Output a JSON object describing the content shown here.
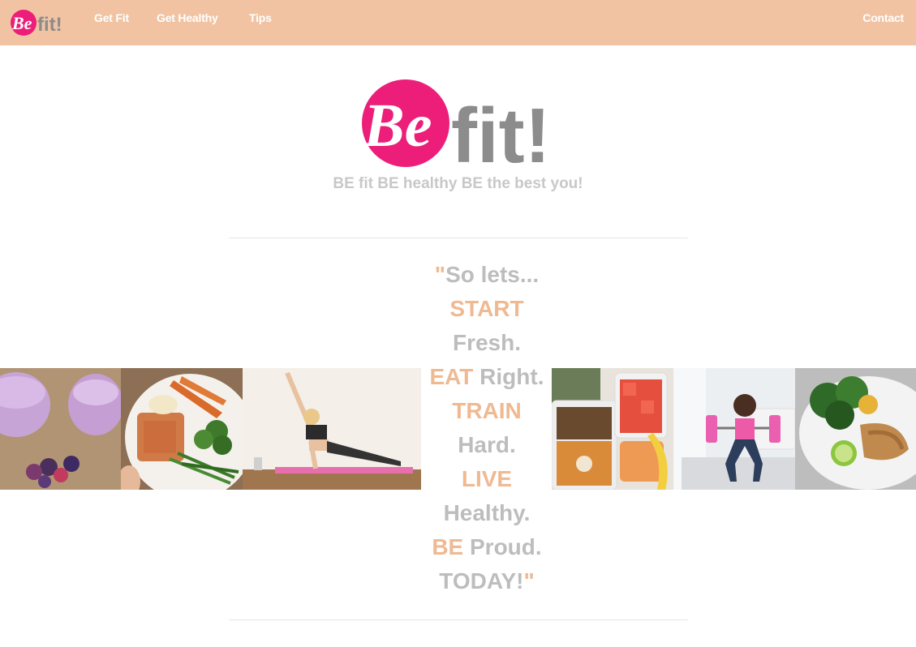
{
  "brand": {
    "logo_be": "Be",
    "logo_fit": "fit!"
  },
  "nav": {
    "links": [
      {
        "label": "Get Fit"
      },
      {
        "label": "Get Healthy"
      },
      {
        "label": "Tips"
      }
    ],
    "contact_label": "Contact"
  },
  "hero": {
    "tagline": "BE fit BE healthy BE the best you!"
  },
  "quote": {
    "open_mark": "\"",
    "line1": "So lets...",
    "line2_accent": "START",
    "line3": "Fresh.",
    "line4_accent": "EAT",
    "line4_rest": " Right.",
    "line5_accent": "TRAIN",
    "line6": "Hard.",
    "line7_accent": "LIVE",
    "line8": "Healthy.",
    "line9_accent": "BE",
    "line9_rest": " Proud.",
    "line10": "TODAY!",
    "close_mark": "\""
  },
  "gallery": {
    "images": [
      {
        "icon": "smoothie-photo"
      },
      {
        "icon": "meal-plate-photo"
      },
      {
        "icon": "side-plank-photo"
      },
      {
        "icon": "meal-prep-photo"
      },
      {
        "icon": "barbell-squat-photo"
      },
      {
        "icon": "chicken-salad-photo"
      }
    ]
  },
  "colors": {
    "navbar": "#f1c3a2",
    "accent": "#efb992",
    "logo_pink": "#ec1e79",
    "logo_gray": "#8c8c8c",
    "text_gray": "#bdbdbd"
  }
}
